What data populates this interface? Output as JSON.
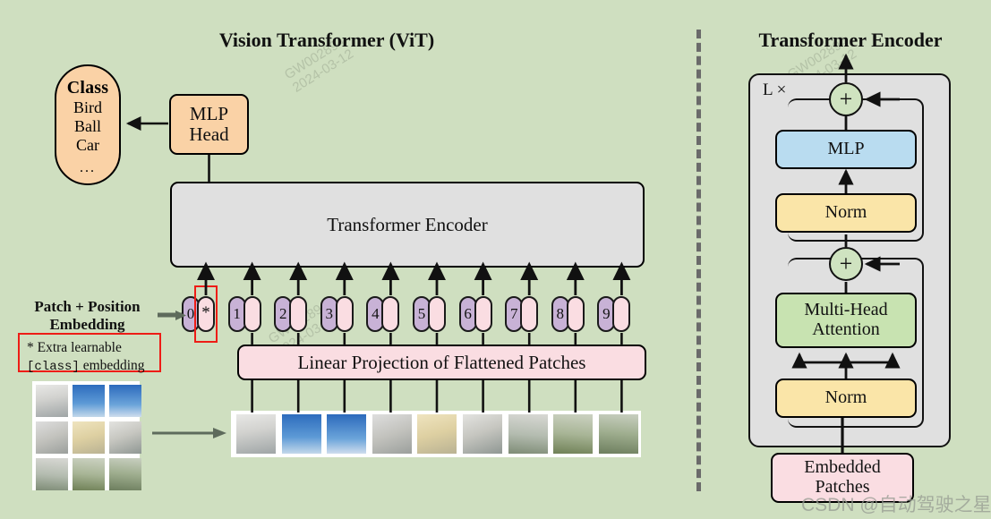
{
  "figure": {
    "left_title": "Vision Transformer (ViT)",
    "right_title": "Transformer Encoder"
  },
  "left_panel": {
    "class_box": {
      "heading": "Class",
      "items": [
        "Bird",
        "Ball",
        "Car"
      ],
      "ellipsis": "...",
      "color": "#fad2a6"
    },
    "mlp_head": {
      "line1": "MLP",
      "line2": "Head",
      "color": "#fad2a6"
    },
    "encoder_bar": {
      "label": "Transformer Encoder",
      "color": "#e0e0e0"
    },
    "linear_projection": {
      "label": "Linear Projection of Flattened Patches",
      "color": "#fadde2"
    },
    "embedding_label": {
      "line1": "Patch + Position",
      "line2": "Embedding"
    },
    "note_box": {
      "line1_prefix": "* Extra learnable",
      "line2_code": "[class]",
      "line2_rest": " embedding",
      "border_color": "#ee1c16"
    },
    "tokens": [
      {
        "num": "0",
        "star": "*",
        "highlighted": true
      },
      {
        "num": "1",
        "star": "",
        "highlighted": false
      },
      {
        "num": "2",
        "star": "",
        "highlighted": false
      },
      {
        "num": "3",
        "star": "",
        "highlighted": false
      },
      {
        "num": "4",
        "star": "",
        "highlighted": false
      },
      {
        "num": "5",
        "star": "",
        "highlighted": false
      },
      {
        "num": "6",
        "star": "",
        "highlighted": false
      },
      {
        "num": "7",
        "star": "",
        "highlighted": false
      },
      {
        "num": "8",
        "star": "",
        "highlighted": false
      },
      {
        "num": "9",
        "star": "",
        "highlighted": false
      }
    ],
    "token_colors": {
      "number_capsule": "#c8b2d6",
      "position_capsule": "#fadde2"
    },
    "source_image_grid_rows": 3,
    "source_image_grid_cols": 3,
    "patch_strip_count": 9
  },
  "right_panel": {
    "repeat_label": "L ×",
    "blocks": [
      {
        "label": "MLP",
        "color": "#b9dcf0"
      },
      {
        "label": "Norm",
        "color": "#fae5a8"
      },
      {
        "label": "Multi-Head\nAttention",
        "line1": "Multi-Head",
        "line2": "Attention",
        "color": "#c8e3b1"
      },
      {
        "label": "Norm",
        "color": "#fae5a8"
      }
    ],
    "mlp_label": "MLP",
    "norm_top_label": "Norm",
    "mha_line1": "Multi-Head",
    "mha_line2": "Attention",
    "norm_bottom_label": "Norm",
    "embedded_patches_line1": "Embedded",
    "embedded_patches_line2": "Patches",
    "residual_symbol": "+",
    "container_color": "#e0e0e0",
    "embedded_patches_color": "#fadde2"
  },
  "watermarks": {
    "tile_line1": "GW002894",
    "tile_line2": "2024-03-12",
    "csdn": "CSDN @自动驾驶之星"
  },
  "colors": {
    "background": "#cfdfc0",
    "accent_red": "#ee1c16",
    "stroke": "#111111"
  }
}
